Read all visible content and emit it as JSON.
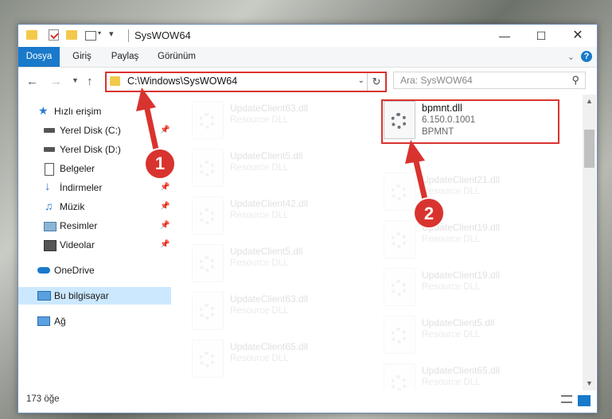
{
  "window": {
    "title": "SysWOW64"
  },
  "quick_access_toolbar": {
    "icons": [
      "folder-icon",
      "properties-icon",
      "new-folder-icon",
      "customize-icon"
    ]
  },
  "ribbon": {
    "tabs": [
      {
        "label": "Dosya",
        "active": true
      },
      {
        "label": "Giriş",
        "active": false
      },
      {
        "label": "Paylaş",
        "active": false
      },
      {
        "label": "Görünüm",
        "active": false
      }
    ],
    "help": "?"
  },
  "navigation": {
    "address": "C:\\Windows\\SysWOW64",
    "search_placeholder": "Ara: SysWOW64"
  },
  "sidebar": {
    "quick_access": "Hızlı erişim",
    "items": [
      {
        "label": "Yerel Disk (C:)",
        "icon": "drive-icon",
        "pinned": true
      },
      {
        "label": "Yerel Disk (D:)",
        "icon": "drive-icon",
        "pinned": false
      },
      {
        "label": "Belgeler",
        "icon": "documents-icon",
        "pinned": true
      },
      {
        "label": "İndirmeler",
        "icon": "downloads-icon",
        "pinned": true
      },
      {
        "label": "Müzik",
        "icon": "music-icon",
        "pinned": true
      },
      {
        "label": "Resimler",
        "icon": "pictures-icon",
        "pinned": true
      },
      {
        "label": "Videolar",
        "icon": "videos-icon",
        "pinned": true
      }
    ],
    "onedrive": "OneDrive",
    "this_pc": "Bu bilgisayar",
    "network": "Ağ"
  },
  "files": {
    "highlighted": {
      "name": "bpmnt.dll",
      "version": "6.150.0.1001",
      "company": "BPMNT"
    },
    "left_column": [
      {
        "name": "UpdateClient63.dll",
        "type": "Resource DLL"
      },
      {
        "name": "UpdateClient5.dll",
        "type": "Resource DLL"
      },
      {
        "name": "UpdateClient42.dll",
        "type": "Resource DLL"
      },
      {
        "name": "UpdateClient5.dll",
        "type": "Resource DLL"
      },
      {
        "name": "UpdateClient63.dll",
        "type": "Resource DLL"
      },
      {
        "name": "UpdateClient65.dll",
        "type": "Resource DLL"
      }
    ],
    "right_column": [
      {
        "name": "UpdateClient21.dll",
        "type": "Resource DLL"
      },
      {
        "name": "UpdateClient19.dll",
        "type": "Resource DLL"
      },
      {
        "name": "UpdateClient19.dll",
        "type": "Resource DLL"
      },
      {
        "name": "UpdateClient5.dll",
        "type": "Resource DLL"
      },
      {
        "name": "UpdateClient65.dll",
        "type": "Resource DLL"
      }
    ]
  },
  "annotations": {
    "step1": "1",
    "step2": "2",
    "color": "#d9332f"
  },
  "status": {
    "item_count": "173 öğe"
  }
}
